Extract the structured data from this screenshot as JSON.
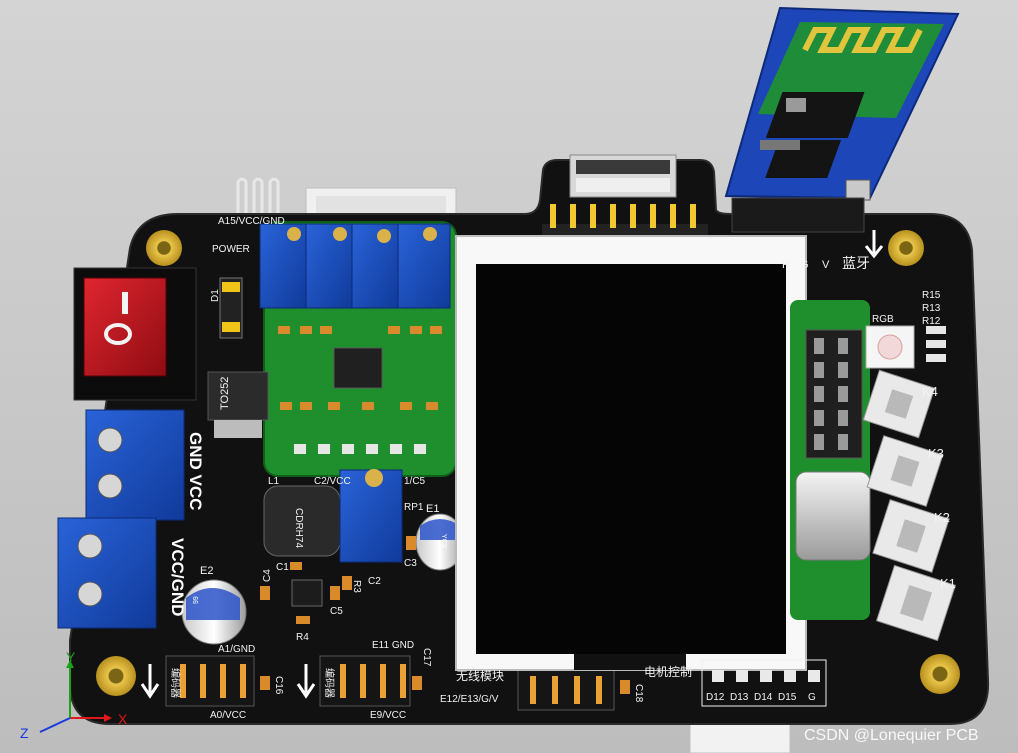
{
  "watermark": "CSDN @Lonequier PCB",
  "axes": {
    "x": "X",
    "y": "Y",
    "z": "Z"
  },
  "silkscreen": {
    "a15_header": "A15/VCC/GND",
    "power_led": "POWER",
    "d1": "D1",
    "chip_to252": "TO252",
    "gnd_vcc": "GND VCC",
    "vcc_gnd": "VCC/GND",
    "l1": "L1",
    "inductor": "CDRH74",
    "c2_vcc": "C2/VCC",
    "c5_partial": "1/C5",
    "rp1": "RP1",
    "e1": "E1",
    "e2": "E2",
    "c1": "C1",
    "c2": "C2",
    "c3": "C3",
    "c4": "C4",
    "c5": "C5",
    "r3": "R3",
    "r4": "R4",
    "a1_gnd": "A1/GND",
    "a0_vcc": "A0/VCC",
    "c16": "C16",
    "c17": "C17",
    "e11_gnd": "E11 GND",
    "e9_vcc": "E9/VCC",
    "encoder_left": "编码器",
    "encoder_right": "编码器",
    "wireless": "无线模块",
    "motor_ctrl": "电机控制",
    "e12_header": "E12/E13/G/V",
    "c18": "C18",
    "pins_bottom": [
      "D12",
      "D13",
      "D14",
      "D15",
      "G"
    ],
    "bt_pins": [
      "R",
      "G",
      "V"
    ],
    "bluetooth": "蓝牙",
    "rgb": "RGB",
    "r15": "R15",
    "r13": "R13",
    "r12": "R12",
    "keys": [
      "K4",
      "K3",
      "K2",
      "K1"
    ],
    "cap_text_1": "YCX",
    "cap_text_2": "99"
  }
}
